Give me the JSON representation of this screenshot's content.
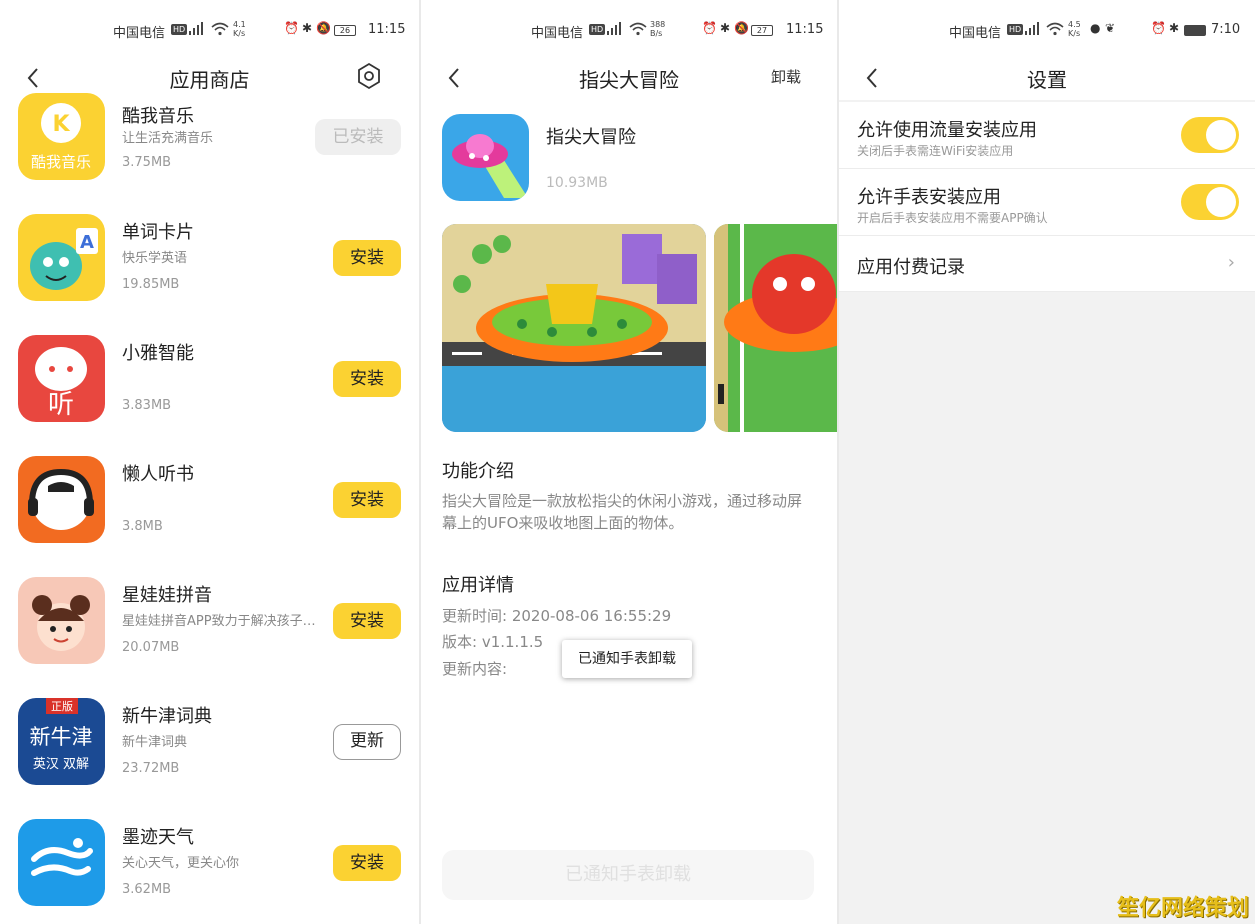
{
  "store": {
    "status": {
      "carrier": "中国电信",
      "speed_top": "4.1",
      "speed_unit": "K/s",
      "battery": "26",
      "time": "11:15"
    },
    "title": "应用商店",
    "apps": [
      {
        "name": "酷我音乐",
        "desc": "让生活充满音乐",
        "size": "3.75MB",
        "button": "已安装",
        "state": "installed",
        "icon_text": "酷我音乐",
        "icon_color": "#fbd232"
      },
      {
        "name": "单词卡片",
        "desc": "快乐学英语",
        "size": "19.85MB",
        "button": "安装",
        "state": "install",
        "icon_text": "A",
        "icon_color": "#fbd232"
      },
      {
        "name": "小雅智能",
        "desc": "",
        "size": "3.83MB",
        "button": "安装",
        "state": "install",
        "icon_text": "听",
        "icon_color": "#e8473f"
      },
      {
        "name": "懒人听书",
        "desc": "",
        "size": "3.8MB",
        "button": "安装",
        "state": "install",
        "icon_text": "",
        "icon_color": "#f26b21"
      },
      {
        "name": "星娃娃拼音",
        "desc": "星娃娃拼音APP致力于解决孩子学习拼音的难题",
        "size": "20.07MB",
        "button": "安装",
        "state": "install",
        "icon_text": "",
        "icon_color": "#f7c8b7"
      },
      {
        "name": "新牛津词典",
        "desc": "新牛津词典",
        "size": "23.72MB",
        "button": "更新",
        "state": "update",
        "icon_text": "新牛津",
        "icon_sub": "英汉 双解",
        "icon_badge": "正版",
        "icon_color": "#1b4a93"
      },
      {
        "name": "墨迹天气",
        "desc": "关心天气，更关心你",
        "size": "3.62MB",
        "button": "安装",
        "state": "install",
        "icon_text": "",
        "icon_color": "#1e9be8"
      }
    ]
  },
  "detail": {
    "status": {
      "carrier": "中国电信",
      "speed_top": "388",
      "speed_unit": "B/s",
      "battery": "27",
      "time": "11:15"
    },
    "title": "指尖大冒险",
    "uninstall": "卸载",
    "app_name": "指尖大冒险",
    "size": "10.93MB",
    "intro_title": "功能介绍",
    "intro_text": "指尖大冒险是一款放松指尖的休闲小游戏，通过移动屏幕上的UFO来吸收地图上面的物体。",
    "details_title": "应用详情",
    "update_time": "更新时间: 2020-08-06 16:55:29",
    "version": "版本: v1.1.1.5",
    "update_content": "更新内容:",
    "toast": "已通知手表卸载",
    "bottom_button": "已通知手表卸载"
  },
  "settings": {
    "status": {
      "carrier": "中国电信",
      "speed_top": "4.5",
      "speed_unit": "K/s",
      "time": "7:10"
    },
    "title": "设置",
    "rows": [
      {
        "label": "允许使用流量安装应用",
        "sub": "关闭后手表需连WiFi安装应用",
        "on": true
      },
      {
        "label": "允许手表安装应用",
        "sub": "开启后手表安装应用不需要APP确认",
        "on": true
      }
    ],
    "record_label": "应用付费记录"
  },
  "watermark": "笙亿网络策划",
  "colors": {
    "accent": "#fbd232"
  }
}
